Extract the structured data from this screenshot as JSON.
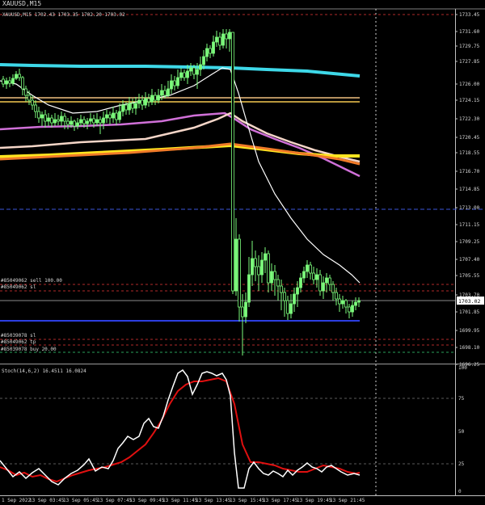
{
  "window": {
    "title": "XAUUSD,M15"
  },
  "main_chart": {
    "header": "XAUUSD,M15  1702.43  1703.35  1702.20  1703.02",
    "price_ticks": [
      "1733.45",
      "1731.60",
      "1729.75",
      "1727.85",
      "1726.00",
      "1724.15",
      "1722.30",
      "1720.45",
      "1718.55",
      "1716.70",
      "1714.85",
      "1713.00",
      "1711.15",
      "1709.25",
      "1707.40",
      "1705.55",
      "1703.70",
      "1703.02",
      "1701.85",
      "1699.95",
      "1698.10",
      "1696.25"
    ],
    "current_price": "1703.02",
    "order_labels": [
      {
        "text": "#85049062 sell 100.00"
      },
      {
        "text": "#85049062 sl"
      },
      {
        "text": "#85039078 sl"
      },
      {
        "text": "#85049062 tp"
      },
      {
        "text": "#85039078 buy 20.00"
      }
    ]
  },
  "stoch": {
    "header": "Stoch(14,6,2) 16.4511 16.0824",
    "levels": [
      "100",
      "75",
      "50",
      "25",
      "0"
    ]
  },
  "time_axis": [
    "1 Sep 2022",
    "13 Sep 03:45",
    "13 Sep 05:45",
    "13 Sep 07:45",
    "13 Sep 09:45",
    "13 Sep 11:45",
    "13 Sep 13:45",
    "13 Sep 15:45",
    "13 Sep 17:45",
    "13 Sep 19:45",
    "13 Sep 21:45"
  ],
  "colors": {
    "background": "#000000",
    "candle": "#7CFC7C",
    "ma_cyan": "#3ed8e8",
    "ma_white": "#f2f2f2",
    "ma_pink": "#f5d6c8",
    "ma_violet": "#d070d8",
    "ma_yellow": "#ffe620",
    "ma_orange": "#f07a28",
    "stoch_main": "#ffffff",
    "stoch_signal": "#e01010"
  }
}
